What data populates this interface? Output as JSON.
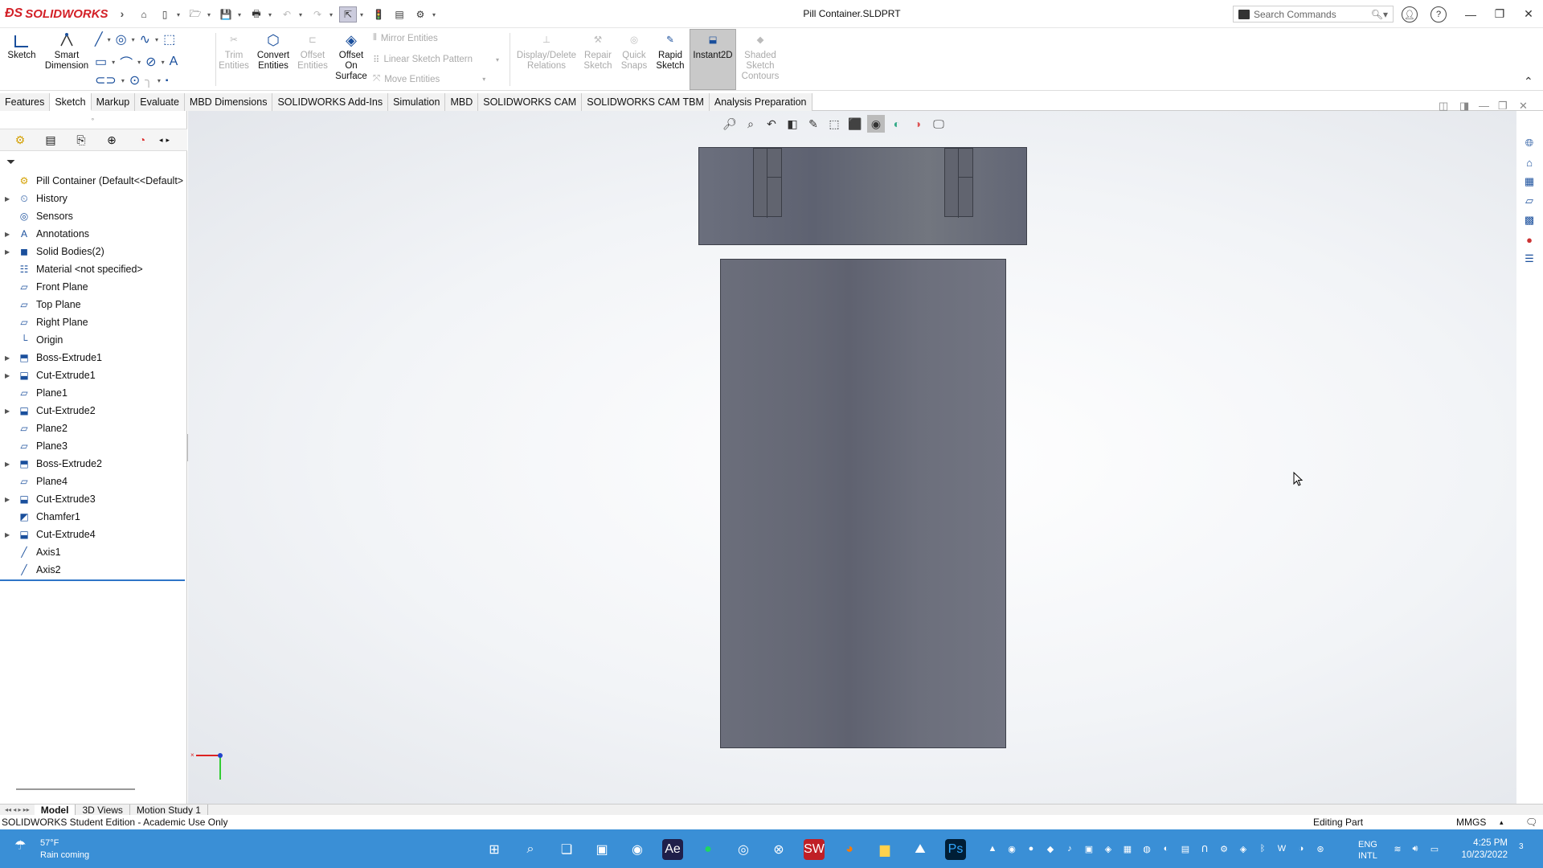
{
  "app": {
    "logo_text": "SOLIDWORKS",
    "doc_title": "Pill Container.SLDPRT",
    "search_placeholder": "Search Commands"
  },
  "ribbon": {
    "sketch": "Sketch",
    "smart_dimension": "Smart\nDimension",
    "trim": "Trim\nEntities",
    "convert": "Convert\nEntities",
    "offset": "Offset\nEntities",
    "offset_surface": "Offset\nOn\nSurface",
    "mirror": "Mirror Entities",
    "linear_pattern": "Linear Sketch Pattern",
    "move": "Move Entities",
    "display_delete": "Display/Delete\nRelations",
    "repair": "Repair\nSketch",
    "quick_snaps": "Quick\nSnaps",
    "rapid": "Rapid\nSketch",
    "instant2d": "Instant2D",
    "shaded": "Shaded\nSketch\nContours"
  },
  "tabs": [
    "Features",
    "Sketch",
    "Markup",
    "Evaluate",
    "MBD Dimensions",
    "SOLIDWORKS Add-Ins",
    "Simulation",
    "MBD",
    "SOLIDWORKS CAM",
    "SOLIDWORKS CAM TBM",
    "Analysis Preparation"
  ],
  "active_tab": "Sketch",
  "tree": [
    {
      "label": "Pill Container  (Default<<Default>",
      "icon": "part-icon",
      "expand": false
    },
    {
      "label": "History",
      "icon": "history-icon",
      "expand": true
    },
    {
      "label": "Sensors",
      "icon": "sensor-icon",
      "expand": false
    },
    {
      "label": "Annotations",
      "icon": "annotation-icon",
      "expand": true
    },
    {
      "label": "Solid Bodies(2)",
      "icon": "solid-bodies-icon",
      "expand": true
    },
    {
      "label": "Material <not specified>",
      "icon": "material-icon",
      "expand": false
    },
    {
      "label": "Front Plane",
      "icon": "plane-icon",
      "expand": false
    },
    {
      "label": "Top Plane",
      "icon": "plane-icon",
      "expand": false
    },
    {
      "label": "Right Plane",
      "icon": "plane-icon",
      "expand": false
    },
    {
      "label": "Origin",
      "icon": "origin-icon",
      "expand": false
    },
    {
      "label": "Boss-Extrude1",
      "icon": "boss-extrude-icon",
      "expand": true
    },
    {
      "label": "Cut-Extrude1",
      "icon": "cut-extrude-icon",
      "expand": true
    },
    {
      "label": "Plane1",
      "icon": "plane-icon",
      "expand": false
    },
    {
      "label": "Cut-Extrude2",
      "icon": "cut-extrude-icon",
      "expand": true
    },
    {
      "label": "Plane2",
      "icon": "plane-icon",
      "expand": false
    },
    {
      "label": "Plane3",
      "icon": "plane-icon",
      "expand": false
    },
    {
      "label": "Boss-Extrude2",
      "icon": "boss-extrude-icon",
      "expand": true
    },
    {
      "label": "Plane4",
      "icon": "plane-icon",
      "expand": false
    },
    {
      "label": "Cut-Extrude3",
      "icon": "cut-extrude-icon",
      "expand": true
    },
    {
      "label": "Chamfer1",
      "icon": "chamfer-icon",
      "expand": false
    },
    {
      "label": "Cut-Extrude4",
      "icon": "cut-extrude-icon",
      "expand": true
    },
    {
      "label": "Axis1",
      "icon": "axis-icon",
      "expand": false
    },
    {
      "label": "Axis2",
      "icon": "axis-icon",
      "expand": false
    }
  ],
  "bottom_tabs": [
    "Model",
    "3D Views",
    "Motion Study 1"
  ],
  "status": {
    "left": "SOLIDWORKS Student Edition - Academic Use Only",
    "mode": "Editing Part",
    "units": "MMGS"
  },
  "taskbar": {
    "weather_temp": "57°F",
    "weather_desc": "Rain coming",
    "lang1": "ENG",
    "lang2": "INTL",
    "time": "4:25 PM",
    "date": "10/23/2022",
    "notif": "3"
  },
  "colors": {
    "accent": "#d32027",
    "taskbar": "#3a8fd6",
    "model_face": "#666977"
  }
}
